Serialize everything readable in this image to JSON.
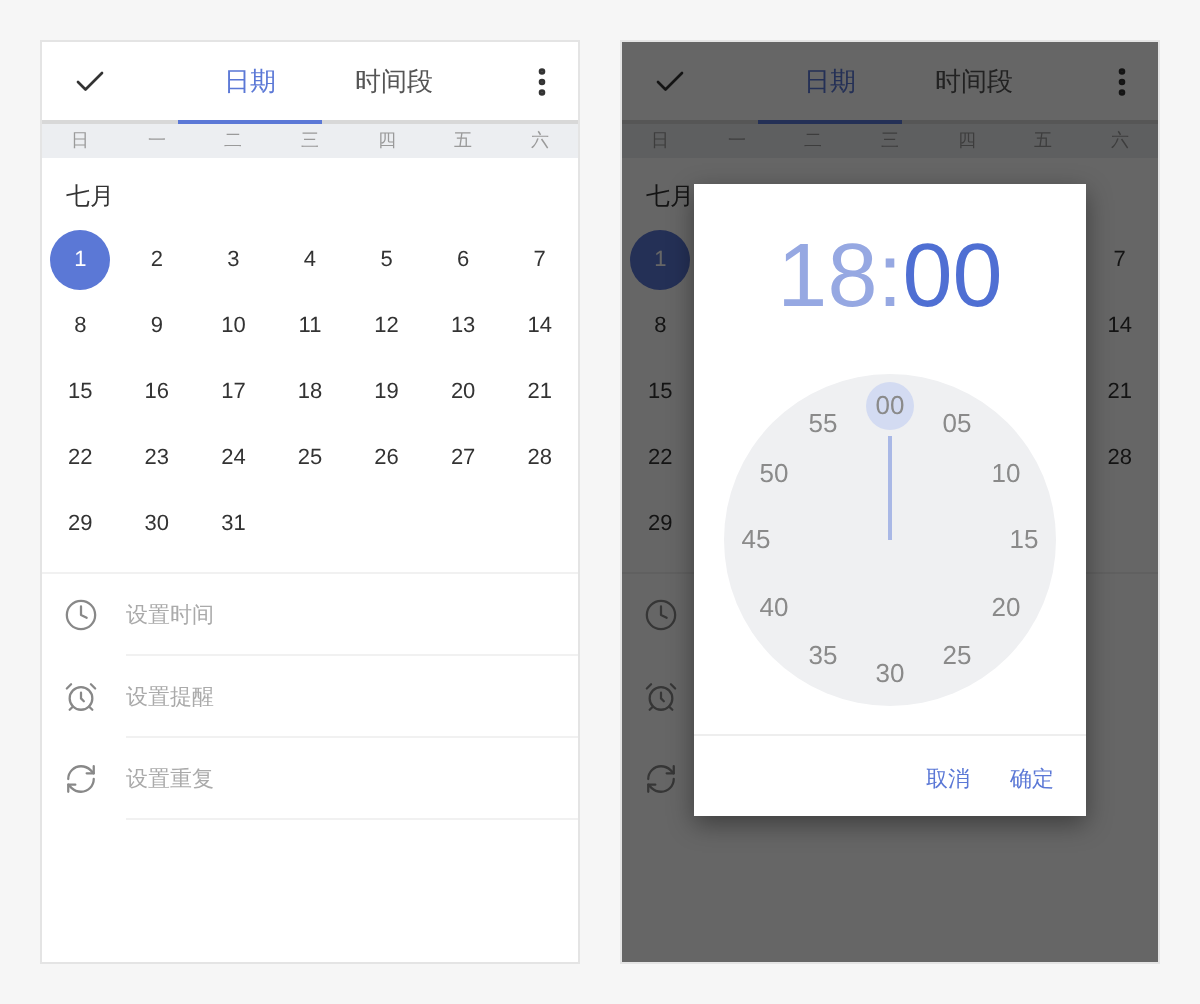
{
  "left_phone": {
    "tabs": [
      {
        "label": "日期",
        "selected": true
      },
      {
        "label": "时间段",
        "selected": false
      }
    ],
    "weekdays": [
      "日",
      "一",
      "二",
      "三",
      "四",
      "五",
      "六"
    ],
    "month": "七月",
    "days": [
      {
        "label": "1",
        "selected": true
      },
      {
        "label": "2",
        "selected": false
      },
      {
        "label": "3",
        "selected": false
      },
      {
        "label": "4",
        "selected": false
      },
      {
        "label": "5",
        "selected": false
      },
      {
        "label": "6",
        "selected": false
      },
      {
        "label": "7",
        "selected": false
      },
      {
        "label": "8",
        "selected": false
      },
      {
        "label": "9",
        "selected": false
      },
      {
        "label": "10",
        "selected": false
      },
      {
        "label": "11",
        "selected": false
      },
      {
        "label": "12",
        "selected": false
      },
      {
        "label": "13",
        "selected": false
      },
      {
        "label": "14",
        "selected": false
      },
      {
        "label": "15",
        "selected": false
      },
      {
        "label": "16",
        "selected": false
      },
      {
        "label": "17",
        "selected": false
      },
      {
        "label": "18",
        "selected": false
      },
      {
        "label": "19",
        "selected": false
      },
      {
        "label": "20",
        "selected": false
      },
      {
        "label": "21",
        "selected": false
      },
      {
        "label": "22",
        "selected": false
      },
      {
        "label": "23",
        "selected": false
      },
      {
        "label": "24",
        "selected": false
      },
      {
        "label": "25",
        "selected": false
      },
      {
        "label": "26",
        "selected": false
      },
      {
        "label": "27",
        "selected": false
      },
      {
        "label": "28",
        "selected": false
      },
      {
        "label": "29",
        "selected": false
      },
      {
        "label": "30",
        "selected": false
      },
      {
        "label": "31",
        "selected": false
      }
    ],
    "options": [
      {
        "kind": "time",
        "label": "设置时间"
      },
      {
        "kind": "alarm",
        "label": "设置提醒"
      },
      {
        "kind": "repeat",
        "label": "设置重复"
      }
    ]
  },
  "right_phone": {
    "dimmed": true,
    "tabs": [
      {
        "label": "日期",
        "selected": true
      },
      {
        "label": "时间段",
        "selected": false
      }
    ],
    "weekdays": [
      "日",
      "一",
      "二",
      "三",
      "四",
      "五",
      "六"
    ],
    "month": "七月",
    "weeks": [
      {
        "sunday": {
          "label": "1",
          "selected": true
        },
        "saturday": {
          "label": "7",
          "selected": false
        }
      },
      {
        "sunday": {
          "label": "8",
          "selected": false
        },
        "saturday": {
          "label": "14",
          "selected": false
        }
      },
      {
        "sunday": {
          "label": "15",
          "selected": false
        },
        "saturday": {
          "label": "21",
          "selected": false
        }
      },
      {
        "sunday": {
          "label": "22",
          "selected": false
        },
        "saturday": {
          "label": "28",
          "selected": false
        }
      },
      {
        "sunday": {
          "label": "29",
          "selected": false
        }
      }
    ],
    "options": [
      {
        "kind": "time"
      },
      {
        "kind": "alarm"
      },
      {
        "kind": "repeat"
      }
    ]
  },
  "time_dialog": {
    "hour": {
      "text": "18",
      "selected": false
    },
    "separator": ":",
    "minute": {
      "text": "00",
      "selected": true
    },
    "dial": [
      {
        "label": "00",
        "selected": true
      },
      {
        "label": "05",
        "selected": false
      },
      {
        "label": "10",
        "selected": false
      },
      {
        "label": "15",
        "selected": false
      },
      {
        "label": "20",
        "selected": false
      },
      {
        "label": "25",
        "selected": false
      },
      {
        "label": "30",
        "selected": false
      },
      {
        "label": "35",
        "selected": false
      },
      {
        "label": "40",
        "selected": false
      },
      {
        "label": "45",
        "selected": false
      },
      {
        "label": "50",
        "selected": false
      },
      {
        "label": "55",
        "selected": false
      }
    ],
    "buttons": [
      "取消",
      "确定"
    ]
  }
}
